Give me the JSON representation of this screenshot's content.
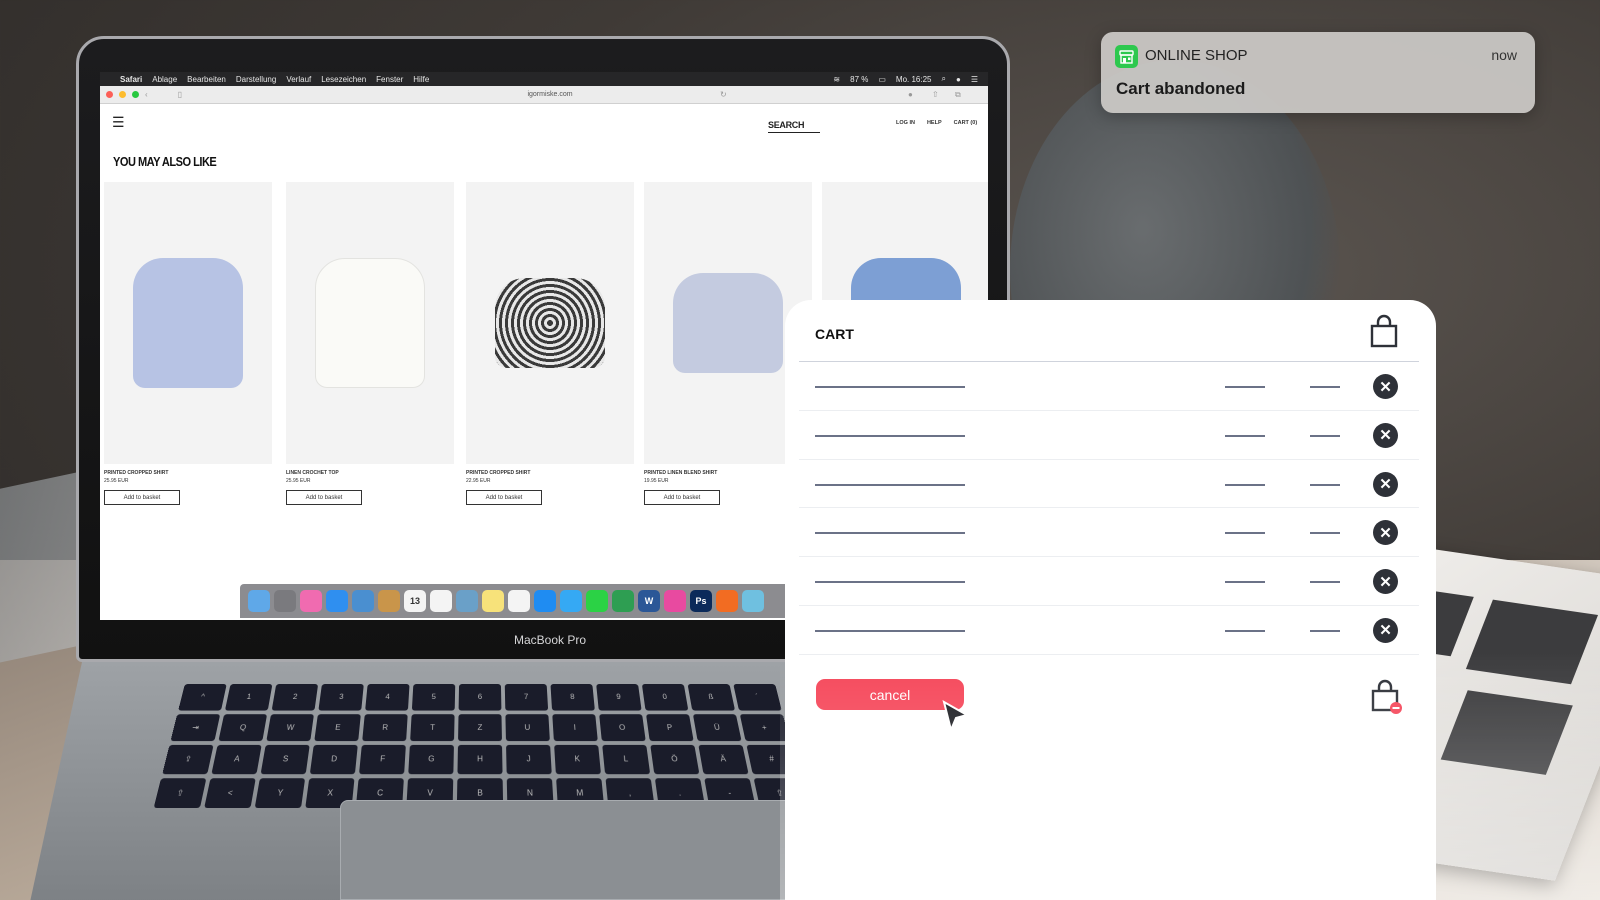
{
  "notification": {
    "app_name": "ONLINE SHOP",
    "time": "now",
    "message": "Cart abandoned",
    "app_icon": "storefront-icon",
    "accent_color": "#2dc84e"
  },
  "laptop": {
    "model_label": "MacBook Pro",
    "menubar": {
      "app": "Safari",
      "items": [
        "Ablage",
        "Bearbeiten",
        "Darstellung",
        "Verlauf",
        "Lesezeichen",
        "Fenster",
        "Hilfe"
      ],
      "battery": "87 %",
      "clock": "Mo. 16:25"
    },
    "browser": {
      "url": "igormiske.com"
    },
    "website": {
      "search_label": "SEARCH",
      "nav_links": [
        "LOG IN",
        "HELP",
        "CART (0)"
      ],
      "section_title": "YOU MAY ALSO LIKE",
      "products": [
        {
          "name": "PRINTED CROPPED SHIRT",
          "price": "25.95 EUR",
          "button": "Add to basket",
          "color": "#b7c3e4"
        },
        {
          "name": "LINEN CROCHET TOP",
          "price": "25.95 EUR",
          "button": "Add to basket",
          "color": "#f7f7f5"
        },
        {
          "name": "PRINTED CROPPED SHIRT",
          "price": "22.95 EUR",
          "button": "Add to basket",
          "color": "#3a3a3a"
        },
        {
          "name": "PRINTED LINEN BLEND SHIRT",
          "price": "19.95 EUR",
          "button": "Add to basket",
          "color": "#c4cbe0"
        },
        {
          "name": "",
          "price": "",
          "button": "",
          "color": "#7d9fd4"
        }
      ]
    },
    "dock_apps": [
      "Finder",
      "System Preferences",
      "iTunes",
      "Safari",
      "Preview",
      "Notes",
      "Calendar",
      "Reminders",
      "Photos Viewer",
      "Stickies",
      "Photos",
      "App Store",
      "Messages",
      "Messages",
      "Google Drive",
      "Word",
      "Display",
      "Ps",
      "Firefox",
      "Folder"
    ],
    "calendar_day": "13"
  },
  "cart": {
    "title": "CART",
    "row_count": 6,
    "cancel_label": "cancel",
    "cancel_color": "#f5475a"
  }
}
